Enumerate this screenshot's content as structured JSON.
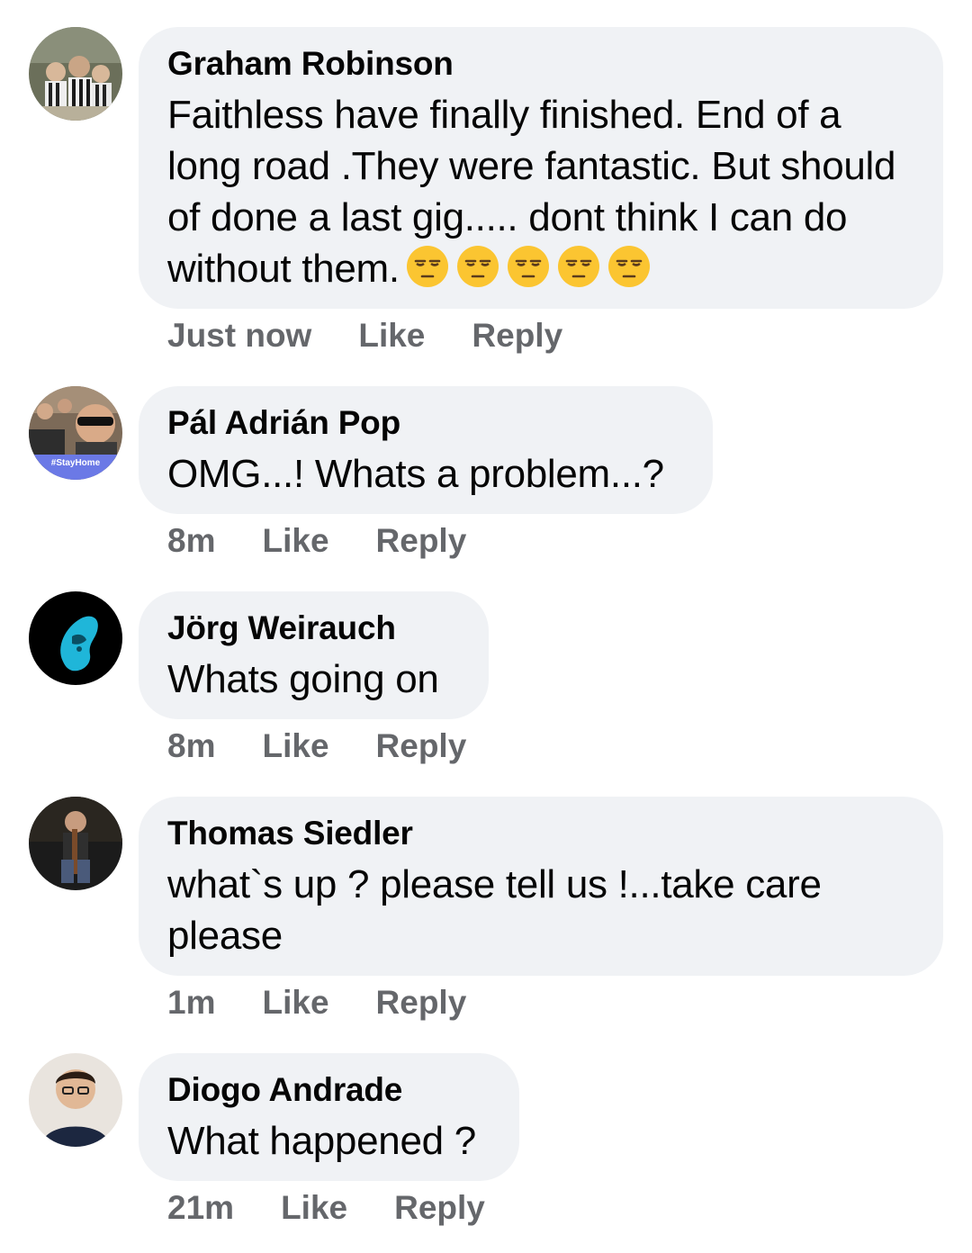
{
  "comments": [
    {
      "author": "Graham Robinson",
      "text": "Faithless have finally finished. End of a long road .They were fantastic. But should of done a last gig..... dont think I can do without them.",
      "emoji": "😒😒😒😒😒",
      "time": "Just now",
      "like": "Like",
      "reply": "Reply"
    },
    {
      "author": "Pál Adrián Pop",
      "text": "OMG...! Whats a problem...?",
      "time": "8m",
      "like": "Like",
      "reply": "Reply",
      "avatar_badge": "#StayHome"
    },
    {
      "author": "Jörg Weirauch",
      "text": "Whats going on",
      "time": "8m",
      "like": "Like",
      "reply": "Reply"
    },
    {
      "author": "Thomas Siedler",
      "text": "what`s up ? please tell us !...take care please",
      "time": "1m",
      "like": "Like",
      "reply": "Reply"
    },
    {
      "author": "Diogo Andrade",
      "text": "What happened ?",
      "time": "21m",
      "like": "Like",
      "reply": "Reply"
    }
  ],
  "colors": {
    "bubble": "#f0f2f5",
    "meta_text": "#65676b",
    "primary_text": "#050505"
  }
}
